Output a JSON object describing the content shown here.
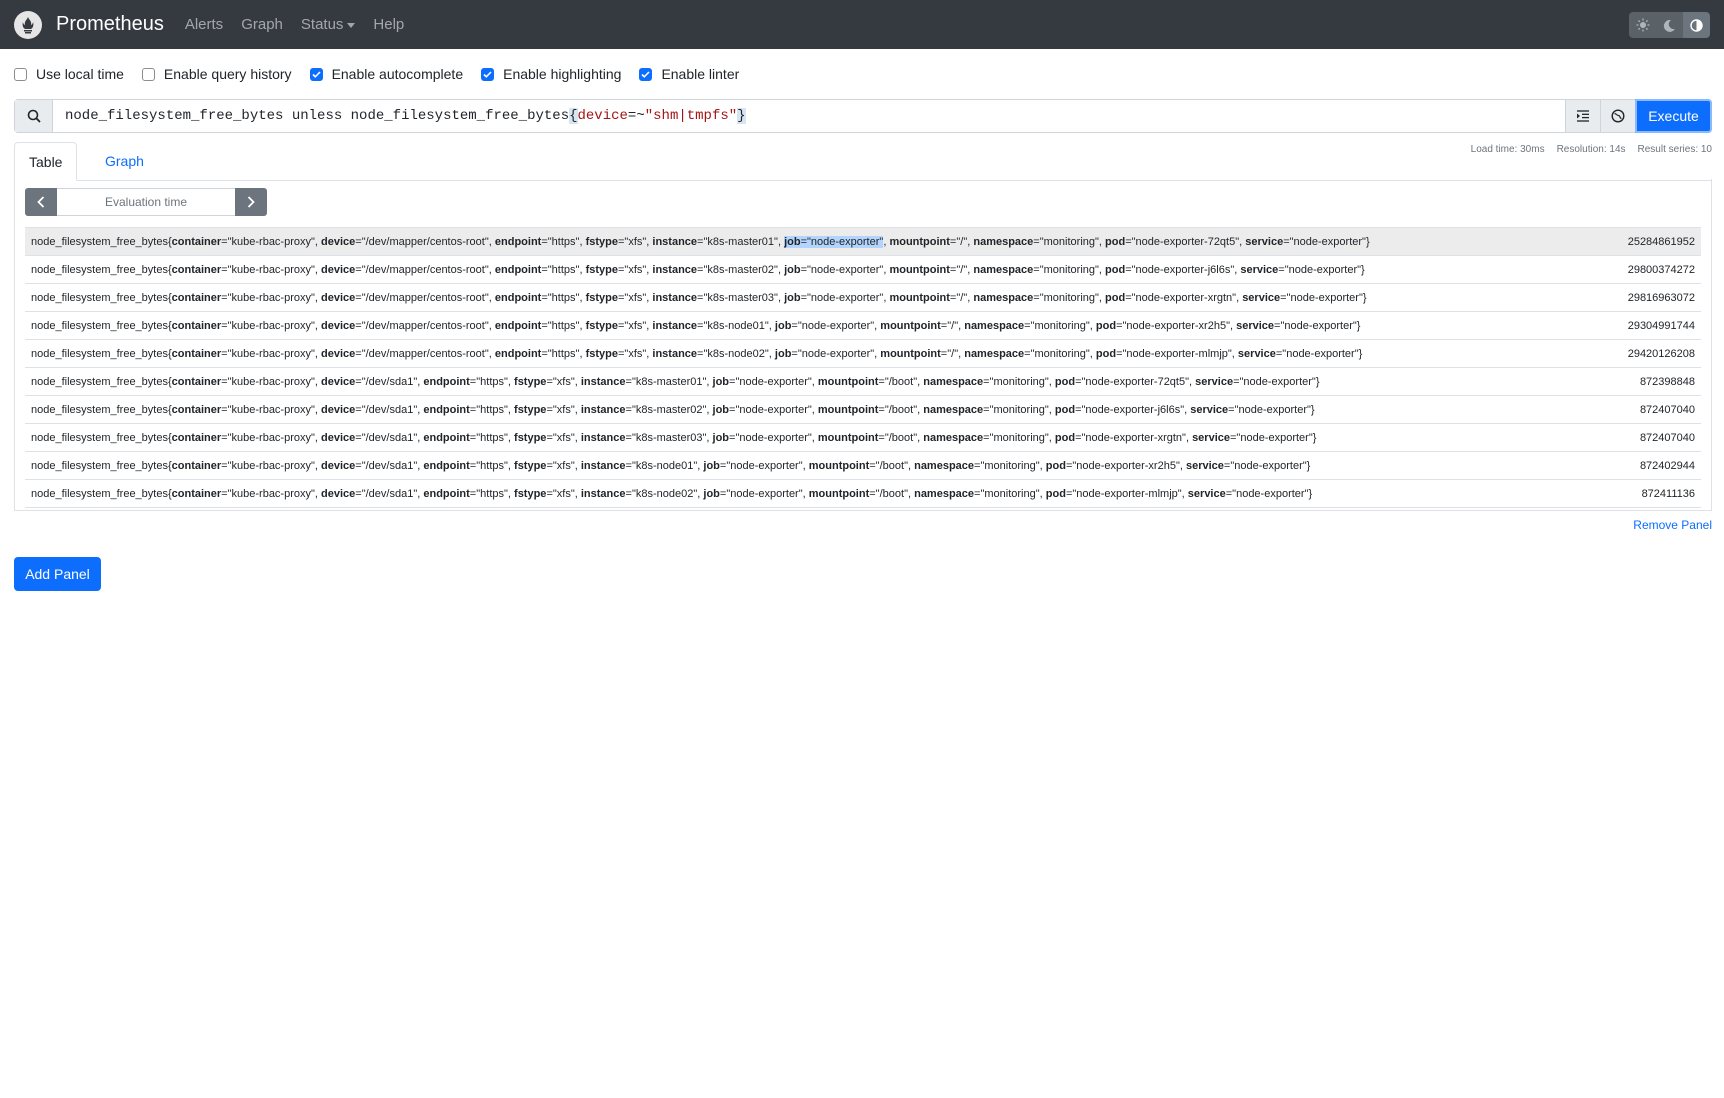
{
  "nav": {
    "brand": "Prometheus",
    "links": [
      "Alerts",
      "Graph",
      "Status",
      "Help"
    ]
  },
  "options": [
    {
      "label": "Use local time",
      "checked": false
    },
    {
      "label": "Enable query history",
      "checked": false
    },
    {
      "label": "Enable autocomplete",
      "checked": true
    },
    {
      "label": "Enable highlighting",
      "checked": true
    },
    {
      "label": "Enable linter",
      "checked": true
    }
  ],
  "query": {
    "part1": "node_filesystem_free_bytes",
    "op": " unless ",
    "part2": "node_filesystem_free_bytes",
    "lbrace": "{",
    "label": "device",
    "matcher": "=~",
    "value": "\"shm|tmpfs\"",
    "rbrace": "}"
  },
  "execute": "Execute",
  "tabs": {
    "table": "Table",
    "graph": "Graph"
  },
  "stats": {
    "load": "Load time: 30ms",
    "resolution": "Resolution: 14s",
    "series": "Result series: 10"
  },
  "eval_placeholder": "Evaluation time",
  "results": [
    {
      "metric": "node_filesystem_free_bytes",
      "container": "kube-rbac-proxy",
      "device": "/dev/mapper/centos-root",
      "endpoint": "https",
      "fstype": "xfs",
      "instance": "k8s-master01",
      "job": "node-exporter",
      "mountpoint": "/",
      "namespace": "monitoring",
      "pod": "node-exporter-72qt5",
      "service": "node-exporter",
      "value": "25284861952"
    },
    {
      "metric": "node_filesystem_free_bytes",
      "container": "kube-rbac-proxy",
      "device": "/dev/mapper/centos-root",
      "endpoint": "https",
      "fstype": "xfs",
      "instance": "k8s-master02",
      "job": "node-exporter",
      "mountpoint": "/",
      "namespace": "monitoring",
      "pod": "node-exporter-j6l6s",
      "service": "node-exporter",
      "value": "29800374272"
    },
    {
      "metric": "node_filesystem_free_bytes",
      "container": "kube-rbac-proxy",
      "device": "/dev/mapper/centos-root",
      "endpoint": "https",
      "fstype": "xfs",
      "instance": "k8s-master03",
      "job": "node-exporter",
      "mountpoint": "/",
      "namespace": "monitoring",
      "pod": "node-exporter-xrgtn",
      "service": "node-exporter",
      "value": "29816963072"
    },
    {
      "metric": "node_filesystem_free_bytes",
      "container": "kube-rbac-proxy",
      "device": "/dev/mapper/centos-root",
      "endpoint": "https",
      "fstype": "xfs",
      "instance": "k8s-node01",
      "job": "node-exporter",
      "mountpoint": "/",
      "namespace": "monitoring",
      "pod": "node-exporter-xr2h5",
      "service": "node-exporter",
      "value": "29304991744"
    },
    {
      "metric": "node_filesystem_free_bytes",
      "container": "kube-rbac-proxy",
      "device": "/dev/mapper/centos-root",
      "endpoint": "https",
      "fstype": "xfs",
      "instance": "k8s-node02",
      "job": "node-exporter",
      "mountpoint": "/",
      "namespace": "monitoring",
      "pod": "node-exporter-mlmjp",
      "service": "node-exporter",
      "value": "29420126208"
    },
    {
      "metric": "node_filesystem_free_bytes",
      "container": "kube-rbac-proxy",
      "device": "/dev/sda1",
      "endpoint": "https",
      "fstype": "xfs",
      "instance": "k8s-master01",
      "job": "node-exporter",
      "mountpoint": "/boot",
      "namespace": "monitoring",
      "pod": "node-exporter-72qt5",
      "service": "node-exporter",
      "value": "872398848"
    },
    {
      "metric": "node_filesystem_free_bytes",
      "container": "kube-rbac-proxy",
      "device": "/dev/sda1",
      "endpoint": "https",
      "fstype": "xfs",
      "instance": "k8s-master02",
      "job": "node-exporter",
      "mountpoint": "/boot",
      "namespace": "monitoring",
      "pod": "node-exporter-j6l6s",
      "service": "node-exporter",
      "value": "872407040"
    },
    {
      "metric": "node_filesystem_free_bytes",
      "container": "kube-rbac-proxy",
      "device": "/dev/sda1",
      "endpoint": "https",
      "fstype": "xfs",
      "instance": "k8s-master03",
      "job": "node-exporter",
      "mountpoint": "/boot",
      "namespace": "monitoring",
      "pod": "node-exporter-xrgtn",
      "service": "node-exporter",
      "value": "872407040"
    },
    {
      "metric": "node_filesystem_free_bytes",
      "container": "kube-rbac-proxy",
      "device": "/dev/sda1",
      "endpoint": "https",
      "fstype": "xfs",
      "instance": "k8s-node01",
      "job": "node-exporter",
      "mountpoint": "/boot",
      "namespace": "monitoring",
      "pod": "node-exporter-xr2h5",
      "service": "node-exporter",
      "value": "872402944"
    },
    {
      "metric": "node_filesystem_free_bytes",
      "container": "kube-rbac-proxy",
      "device": "/dev/sda1",
      "endpoint": "https",
      "fstype": "xfs",
      "instance": "k8s-node02",
      "job": "node-exporter",
      "mountpoint": "/boot",
      "namespace": "monitoring",
      "pod": "node-exporter-mlmjp",
      "service": "node-exporter",
      "value": "872411136"
    }
  ],
  "remove_panel": "Remove Panel",
  "add_panel": "Add Panel",
  "colors": {
    "navbar": "#343a40",
    "primary": "#0d6efd"
  },
  "icons": [
    "prometheus-logo-icon",
    "sun-icon",
    "moon-icon",
    "contrast-icon",
    "search-icon",
    "format-icon",
    "metrics-explorer-icon",
    "chevron-left-icon",
    "chevron-right-icon"
  ]
}
